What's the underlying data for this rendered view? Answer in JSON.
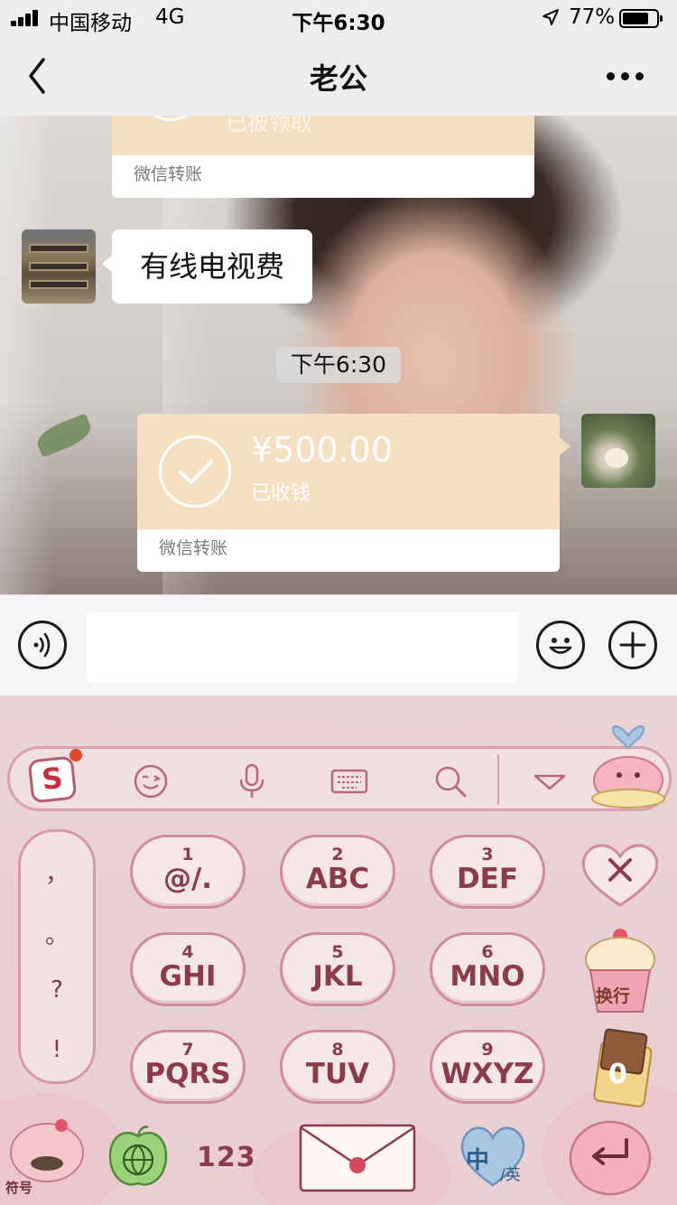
{
  "status_bar": {
    "carrier": "中国移动",
    "network": "4G",
    "time": "下午6:30",
    "battery_percent": "77%",
    "battery_level": 0.77
  },
  "nav": {
    "title": "老公",
    "back_icon": "chevron-left-icon",
    "more_icon": "more-dots-icon"
  },
  "messages": {
    "top_transfer": {
      "status": "已被领取",
      "label": "微信转账"
    },
    "text_message": "有线电视费",
    "time_divider": "下午6:30",
    "transfer": {
      "amount": "¥500.00",
      "status": "已收钱",
      "label": "微信转账"
    }
  },
  "input_bar": {
    "voice_icon": "voice-icon",
    "emoji_icon": "emoji-icon",
    "plus_icon": "plus-icon",
    "message_value": ""
  },
  "keyboard": {
    "toolbar_icons": [
      "sogou-logo-icon",
      "wink-emoji-icon",
      "microphone-icon",
      "keyboard-icon",
      "search-icon",
      "collapse-triangle-icon"
    ],
    "side_symbols": [
      "，",
      "。",
      "?",
      "!"
    ],
    "keys": [
      {
        "num": "1",
        "letters": "@/."
      },
      {
        "num": "2",
        "letters": "ABC"
      },
      {
        "num": "3",
        "letters": "DEF"
      },
      {
        "num": "4",
        "letters": "GHI"
      },
      {
        "num": "5",
        "letters": "JKL"
      },
      {
        "num": "6",
        "letters": "MNO"
      },
      {
        "num": "7",
        "letters": "PQRS"
      },
      {
        "num": "8",
        "letters": "TUV"
      },
      {
        "num": "9",
        "letters": "WXYZ"
      }
    ],
    "delete_icon": "delete-x-icon",
    "newline_label": "换行",
    "zero_label": "0",
    "symbol_label": "符号",
    "number_label": "123",
    "lang_label": "中",
    "lang_sub": "/英",
    "colors": {
      "key_text": "#8b3c48",
      "key_border": "#cf8c99",
      "keyboard_bg": "#e8cfd3"
    }
  }
}
